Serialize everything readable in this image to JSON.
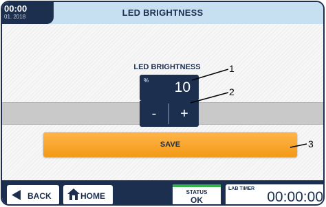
{
  "header": {
    "time": "00:00",
    "date": "01. 2018",
    "title": "LED BRIGHTNESS"
  },
  "setting": {
    "label": "LED BRIGHTNESS",
    "unit": "%",
    "value": "10",
    "minus_label": "-",
    "plus_label": "+"
  },
  "save_label": "SAVE",
  "callouts": [
    "1",
    "2",
    "3"
  ],
  "footer": {
    "back_label": "BACK",
    "home_label": "HOME",
    "status_title": "STATUS",
    "status_value": "OK",
    "timer_title": "LAB TIMER",
    "timer_value": "00:00:00"
  },
  "colors": {
    "navy": "#1c2f4f",
    "header_bg": "#c7e0f1",
    "save_orange": "#f39a17",
    "status_green": "#35b34a"
  },
  "icons": {
    "back": "triangle-left-icon",
    "home": "home-icon"
  }
}
